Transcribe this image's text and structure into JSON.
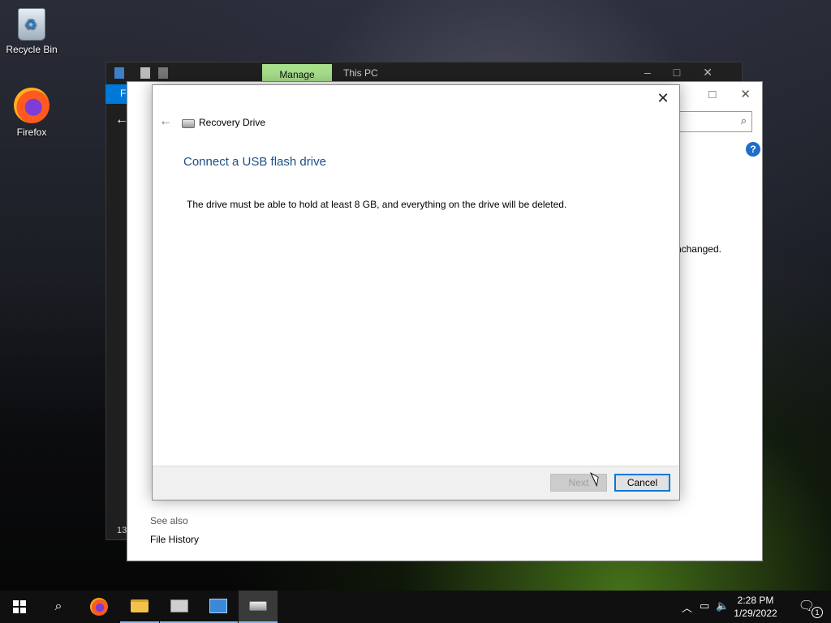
{
  "desktop": {
    "icons": [
      {
        "label": "Recycle Bin",
        "icon": "recycle-bin-icon"
      },
      {
        "label": "Firefox",
        "icon": "firefox-icon"
      }
    ]
  },
  "explorer_back": {
    "manage_tab": "Manage",
    "location": "This PC",
    "ribbon_letter": "F",
    "status_count": "13"
  },
  "explorer_mid": {
    "unchanged_text": "nchanged.",
    "see_also": "See also",
    "file_history": "File History",
    "help": "?"
  },
  "dialog": {
    "title": "Recovery Drive",
    "heading": "Connect a USB flash drive",
    "body": "The drive must be able to hold at least 8 GB, and everything on the drive will be deleted.",
    "next_label": "Next",
    "cancel_label": "Cancel",
    "close_glyph": "✕",
    "back_glyph": "←"
  },
  "taskbar": {
    "time": "2:28 PM",
    "date": "1/29/2022",
    "notification_count": "1"
  },
  "colors": {
    "heading_blue": "#1d4e87",
    "manage_tab_green": "#a8df8a",
    "accent": "#0078d7"
  }
}
